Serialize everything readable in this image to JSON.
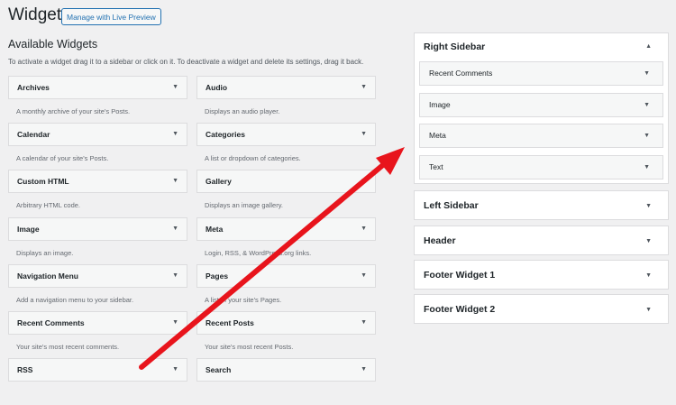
{
  "header": {
    "title": "Widgets",
    "live_preview_label": "Manage with Live Preview"
  },
  "available": {
    "title": "Available Widgets",
    "description": "To activate a widget drag it to a sidebar or click on it. To deactivate a widget and delete its settings, drag it back.",
    "widgets": [
      {
        "label": "Archives",
        "desc": "A monthly archive of your site's Posts."
      },
      {
        "label": "Audio",
        "desc": "Displays an audio player."
      },
      {
        "label": "Calendar",
        "desc": "A calendar of your site's Posts."
      },
      {
        "label": "Categories",
        "desc": "A list or dropdown of categories."
      },
      {
        "label": "Custom HTML",
        "desc": "Arbitrary HTML code."
      },
      {
        "label": "Gallery",
        "desc": "Displays an image gallery."
      },
      {
        "label": "Image",
        "desc": "Displays an image."
      },
      {
        "label": "Meta",
        "desc": "Login, RSS, & WordPress.org links."
      },
      {
        "label": "Navigation Menu",
        "desc": "Add a navigation menu to your sidebar."
      },
      {
        "label": "Pages",
        "desc": "A list of your site's Pages."
      },
      {
        "label": "Recent Comments",
        "desc": "Your site's most recent comments."
      },
      {
        "label": "Recent Posts",
        "desc": "Your site's most recent Posts."
      },
      {
        "label": "RSS",
        "desc": ""
      },
      {
        "label": "Search",
        "desc": ""
      }
    ]
  },
  "sidebars": {
    "right": {
      "title": "Right Sidebar",
      "widgets": [
        "Recent Comments",
        "Image",
        "Meta",
        "Text"
      ]
    },
    "left": {
      "title": "Left Sidebar"
    },
    "header": {
      "title": "Header"
    },
    "footer1": {
      "title": "Footer Widget 1"
    },
    "footer2": {
      "title": "Footer Widget 2"
    }
  },
  "colors": {
    "arrow": "#e8141c",
    "link_blue": "#2271b1"
  }
}
